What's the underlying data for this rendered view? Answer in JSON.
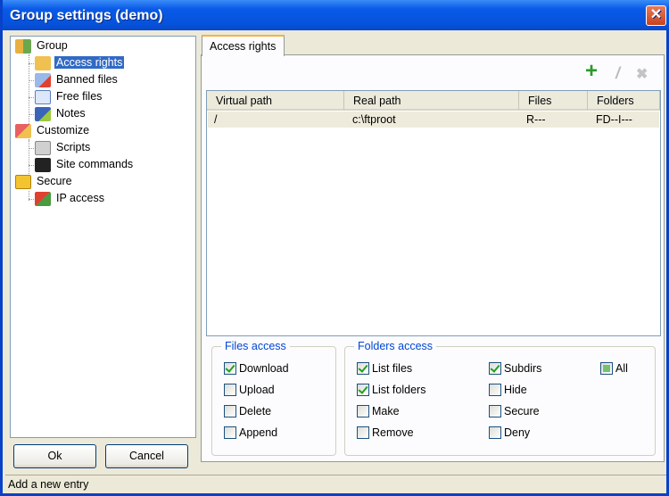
{
  "window": {
    "title": "Group settings (demo)",
    "close": "✕"
  },
  "tree": [
    {
      "label": "Group",
      "icon": "users-icon",
      "level": 0
    },
    {
      "label": "Access rights",
      "icon": "folder-access-icon",
      "level": 1,
      "selected": true
    },
    {
      "label": "Banned files",
      "icon": "banned-file-icon",
      "level": 1
    },
    {
      "label": "Free files",
      "icon": "file-icon",
      "level": 1
    },
    {
      "label": "Notes",
      "icon": "notes-icon",
      "level": 1
    },
    {
      "label": "Customize",
      "icon": "customize-icon",
      "level": 0
    },
    {
      "label": "Scripts",
      "icon": "script-icon",
      "level": 1
    },
    {
      "label": "Site commands",
      "icon": "console-icon",
      "level": 1
    },
    {
      "label": "Secure",
      "icon": "lock-icon",
      "level": 0
    },
    {
      "label": "IP access",
      "icon": "ip-access-icon",
      "level": 1
    }
  ],
  "buttons": {
    "ok": "Ok",
    "cancel": "Cancel"
  },
  "status": "Add a new entry",
  "tab": "Access rights",
  "toolbar": {
    "add": "+",
    "edit": "/",
    "delete": "✖"
  },
  "list": {
    "columns": [
      "Virtual path",
      "Real path",
      "Files",
      "Folders"
    ],
    "rows": [
      [
        "/",
        "c:\\ftproot",
        "R---",
        "FD--I---"
      ]
    ]
  },
  "files_access": {
    "title": "Files access",
    "items": [
      {
        "label": "Download",
        "checked": true
      },
      {
        "label": "Upload",
        "checked": false
      },
      {
        "label": "Delete",
        "checked": false
      },
      {
        "label": "Append",
        "checked": false
      }
    ]
  },
  "folders_access": {
    "title": "Folders access",
    "items": [
      {
        "label": "List files",
        "checked": true
      },
      {
        "label": "List folders",
        "checked": true
      },
      {
        "label": "Make",
        "checked": false
      },
      {
        "label": "Remove",
        "checked": false
      },
      {
        "label": "Subdirs",
        "checked": true
      },
      {
        "label": "Hide",
        "checked": false
      },
      {
        "label": "Secure",
        "checked": false
      },
      {
        "label": "Deny",
        "checked": false
      },
      {
        "label": "All",
        "checked": "mixed"
      }
    ]
  }
}
